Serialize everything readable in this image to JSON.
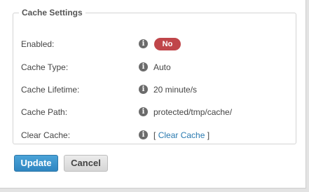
{
  "fieldset": {
    "legend": "Cache Settings"
  },
  "rows": [
    {
      "label": "Enabled:",
      "value": "No",
      "type": "badge"
    },
    {
      "label": "Cache Type:",
      "value": "Auto",
      "type": "text"
    },
    {
      "label": "Cache Lifetime:",
      "value": "20 minute/s",
      "type": "text"
    },
    {
      "label": "Cache Path:",
      "value": "protected/tmp/cache/",
      "type": "text"
    },
    {
      "label": "Clear Cache:",
      "value": "Clear Cache",
      "type": "link",
      "bracket_open": "[",
      "bracket_close": "]"
    }
  ],
  "info_icon_glyph": "i",
  "buttons": {
    "update": "Update",
    "cancel": "Cancel"
  },
  "colors": {
    "badge_no": "#c0464a",
    "link": "#2a7ab0",
    "update_button": "#3a93cc"
  }
}
